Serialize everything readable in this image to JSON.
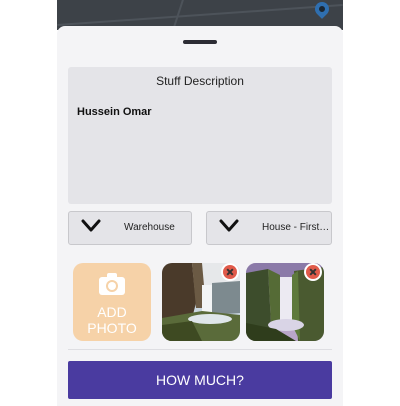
{
  "description": {
    "title": "Stuff Description",
    "text": "Hussein Omar"
  },
  "dropdowns": {
    "from": {
      "value": "Warehouse",
      "icon": "chevron-down-icon"
    },
    "to": {
      "value": "House - First…",
      "icon": "chevron-down-icon"
    }
  },
  "photos": {
    "add_label_line1": "ADD",
    "add_label_line2": "PHOTO",
    "add_icon": "camera-icon",
    "remove_icon": "close-icon",
    "count": 2
  },
  "action": {
    "button_label": "HOW MUCH?"
  },
  "colors": {
    "accent": "#4a3ba0",
    "add_photo_bg": "#f6d2a8",
    "remove_badge": "#e05a4a"
  }
}
